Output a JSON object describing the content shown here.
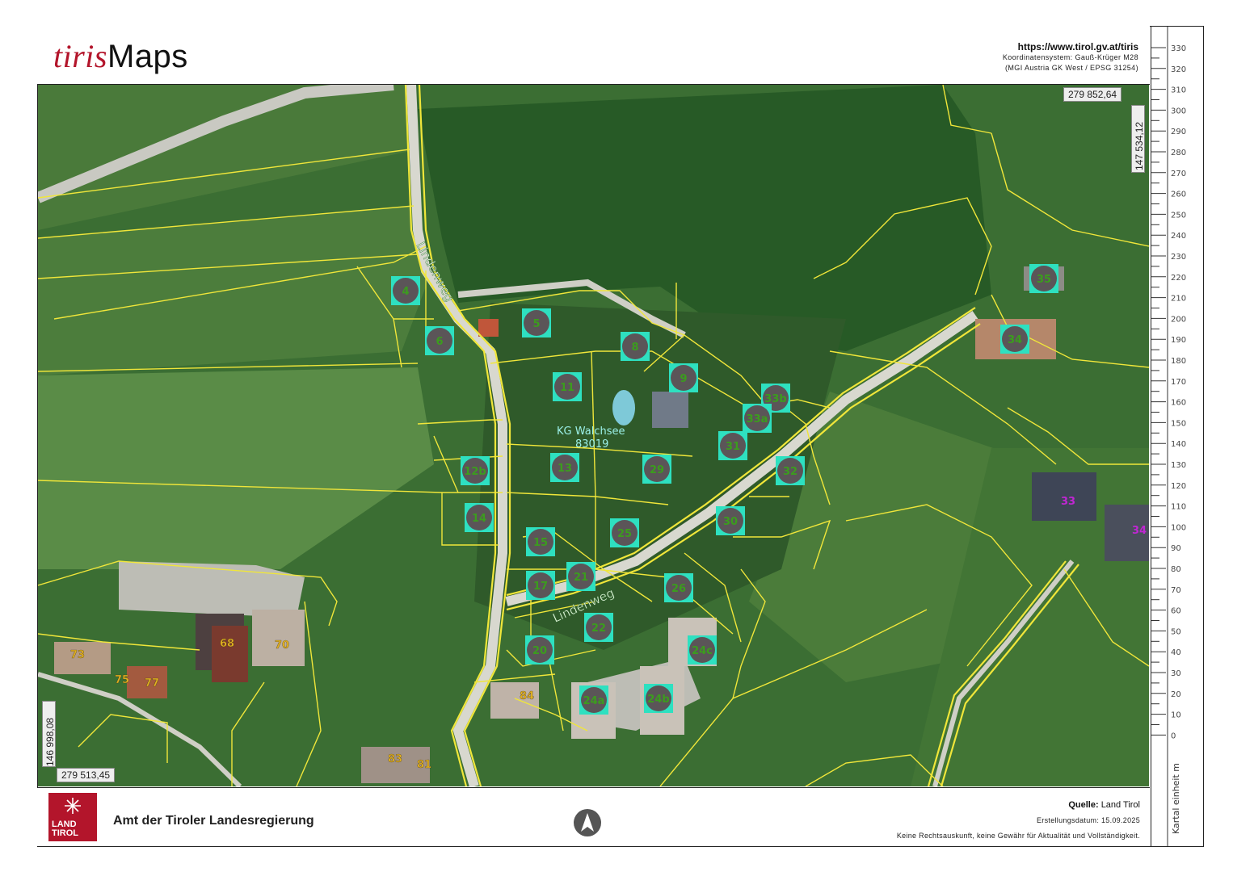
{
  "header": {
    "logo_brand": "tiris",
    "logo_suffix": "Maps",
    "url": "https://www.tirol.gv.at/tiris",
    "crs_line1": "Koordinatensystem: Gauß-Krüger M28",
    "crs_line2": "(MGI Austria GK West / EPSG 31254)"
  },
  "coordinates": {
    "top_right_x": "279 852,64",
    "top_right_y": "147 534,12",
    "bottom_left_x": "279 513,45",
    "bottom_left_y": "146 998,08"
  },
  "scale": {
    "unit_label": "Kartal einheit m",
    "ticks": [
      "330",
      "320",
      "310",
      "300",
      "290",
      "280",
      "270",
      "260",
      "250",
      "240",
      "230",
      "220",
      "210",
      "200",
      "190",
      "180",
      "170",
      "160",
      "150",
      "140",
      "130",
      "120",
      "110",
      "100",
      "90",
      "80",
      "70",
      "60",
      "50",
      "40",
      "30",
      "20",
      "10",
      "0"
    ]
  },
  "map": {
    "colors": {
      "parcel_line": "#f0e63a",
      "marker_fill": "#2ee0c0",
      "marker_text": "#3c9c1e",
      "road": "#d8d8cf"
    },
    "streets": [
      "Lindenweg",
      "Lindenweg"
    ],
    "cadastral_name": "KG Walchsee",
    "cadastral_number": "83019",
    "parcels": [
      "4",
      "5",
      "6",
      "8",
      "9",
      "11",
      "33b",
      "33a",
      "31",
      "12b",
      "13",
      "29",
      "32",
      "14",
      "30",
      "15",
      "25",
      "17",
      "21",
      "26",
      "22",
      "20",
      "24c",
      "24a",
      "24b",
      "35",
      "34"
    ],
    "house_numbers": [
      "73",
      "68",
      "70",
      "75",
      "77",
      "84",
      "83",
      "81"
    ],
    "neighbour_numbers": [
      "33",
      "34"
    ]
  },
  "footer": {
    "logo_line1": "LAND",
    "logo_line2": "TIROL",
    "agency": "Amt der Tiroler Landesregierung",
    "source_label": "Quelle:",
    "source_value": "Land Tirol",
    "date_label": "Erstellungsdatum:",
    "date_value": "15.09.2025",
    "disclaimer": "Keine Rechtsauskunft, keine Gewähr für Aktualität und Vollständigkeit."
  }
}
